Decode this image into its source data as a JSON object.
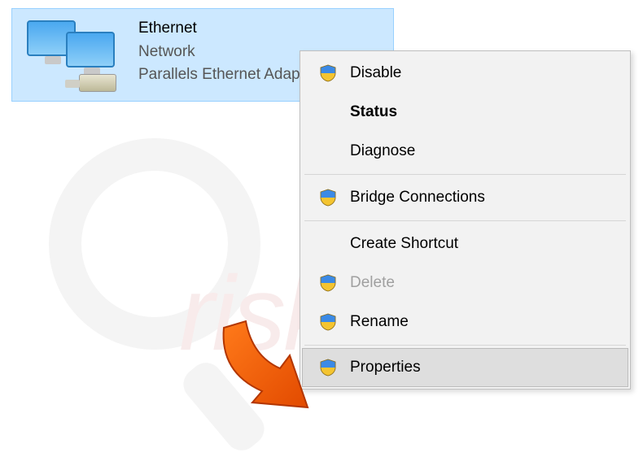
{
  "adapter": {
    "title": "Ethernet",
    "network": "Network",
    "device": "Parallels Ethernet Adapter"
  },
  "menu": {
    "items": [
      {
        "label": "Disable",
        "shield": true,
        "bold": false,
        "disabled": false,
        "hover": false
      },
      {
        "label": "Status",
        "shield": false,
        "bold": true,
        "disabled": false,
        "hover": false
      },
      {
        "label": "Diagnose",
        "shield": false,
        "bold": false,
        "disabled": false,
        "hover": false
      },
      {
        "sep": true
      },
      {
        "label": "Bridge Connections",
        "shield": true,
        "bold": false,
        "disabled": false,
        "hover": false
      },
      {
        "sep": true
      },
      {
        "label": "Create Shortcut",
        "shield": false,
        "bold": false,
        "disabled": false,
        "hover": false
      },
      {
        "label": "Delete",
        "shield": true,
        "bold": false,
        "disabled": true,
        "hover": false
      },
      {
        "label": "Rename",
        "shield": true,
        "bold": false,
        "disabled": false,
        "hover": false
      },
      {
        "sep": true
      },
      {
        "label": "Properties",
        "shield": true,
        "bold": false,
        "disabled": false,
        "hover": true
      }
    ]
  },
  "annotation": {
    "arrow_target": "Properties"
  }
}
